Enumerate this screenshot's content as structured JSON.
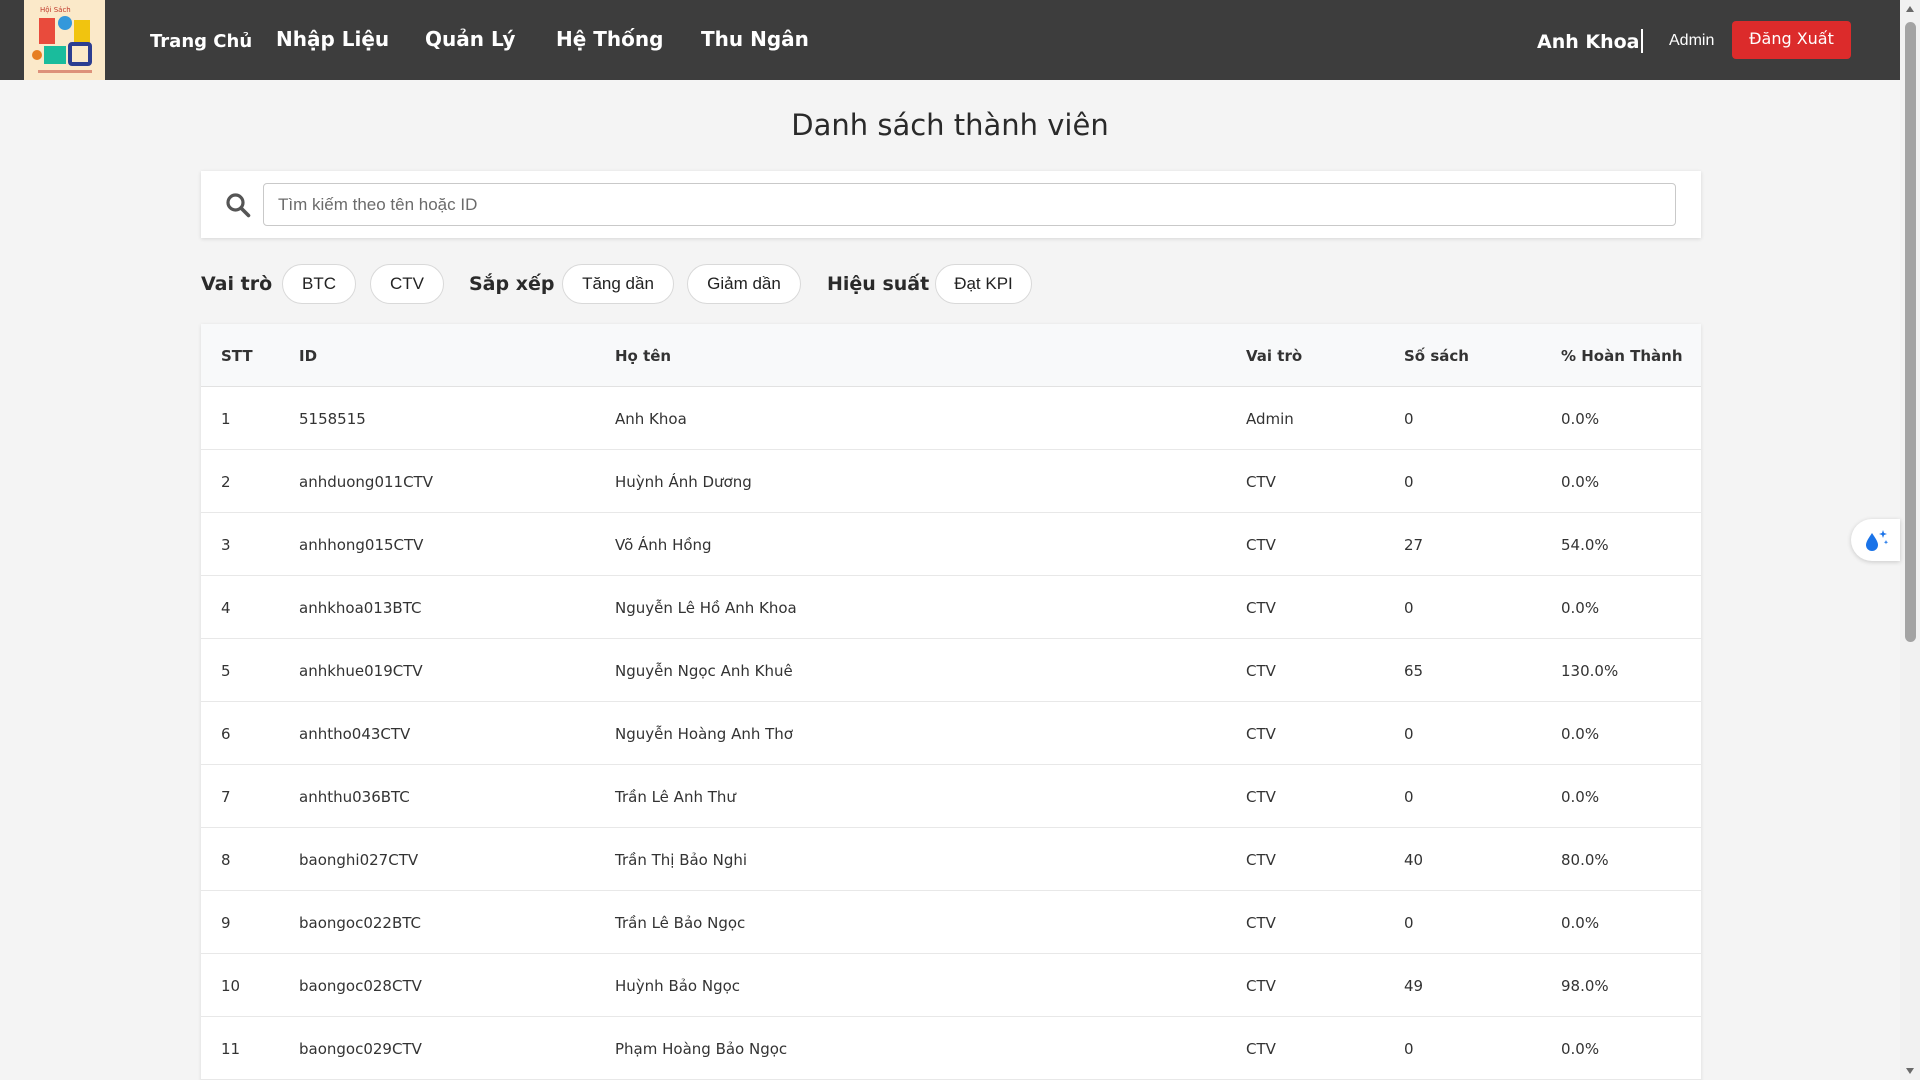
{
  "navbar": {
    "logo_alt": "Hội Sách",
    "links": [
      "Trang Chủ",
      "Nhập Liệu",
      "Quản Lý",
      "Hệ Thống",
      "Thu Ngân"
    ],
    "user_name": "Anh Khoa",
    "user_role": "Admin",
    "logout_label": "Đăng Xuất",
    "bg_color": "#3d3d3d",
    "accent_color": "#dc2b2b"
  },
  "page": {
    "title": "Danh sách thành viên"
  },
  "search": {
    "placeholder": "Tìm kiếm theo tên hoặc ID",
    "value": ""
  },
  "filters": {
    "role_label": "Vai trò",
    "role_options": [
      "BTC",
      "CTV"
    ],
    "sort_label": "Sắp xếp",
    "sort_options": [
      "Tăng dần",
      "Giảm dần"
    ],
    "performance_label": "Hiệu suất",
    "performance_options": [
      "Đạt KPI"
    ]
  },
  "table": {
    "headers": [
      "STT",
      "ID",
      "Họ tên",
      "Vai trò",
      "Số sách",
      "% Hoàn Thành"
    ],
    "rows": [
      [
        "1",
        "5158515",
        "Anh Khoa",
        "Admin",
        "0",
        "0.0%"
      ],
      [
        "2",
        "anhduong011CTV",
        "Huỳnh Ánh Dương",
        "CTV",
        "0",
        "0.0%"
      ],
      [
        "3",
        "anhhong015CTV",
        "Võ Ánh Hồng",
        "CTV",
        "27",
        "54.0%"
      ],
      [
        "4",
        "anhkhoa013BTC",
        "Nguyễn Lê Hồ Anh Khoa",
        "CTV",
        "0",
        "0.0%"
      ],
      [
        "5",
        "anhkhue019CTV",
        "Nguyễn Ngọc Anh Khuê",
        "CTV",
        "65",
        "130.0%"
      ],
      [
        "6",
        "anhtho043CTV",
        "Nguyễn Hoàng Anh Thơ",
        "CTV",
        "0",
        "0.0%"
      ],
      [
        "7",
        "anhthu036BTC",
        "Trần Lê Anh Thư",
        "CTV",
        "0",
        "0.0%"
      ],
      [
        "8",
        "baonghi027CTV",
        "Trần Thị Bảo Nghi",
        "CTV",
        "40",
        "80.0%"
      ],
      [
        "9",
        "baongoc022BTC",
        "Trần Lê Bảo Ngọc",
        "CTV",
        "0",
        "0.0%"
      ],
      [
        "10",
        "baongoc028CTV",
        "Huỳnh Bảo Ngọc",
        "CTV",
        "49",
        "98.0%"
      ],
      [
        "11",
        "baongoc029CTV",
        "Phạm Hoàng Bảo Ngọc",
        "CTV",
        "0",
        "0.0%"
      ]
    ]
  },
  "widgets": {
    "floating_icon": "water-drop-sparkle-icon"
  }
}
